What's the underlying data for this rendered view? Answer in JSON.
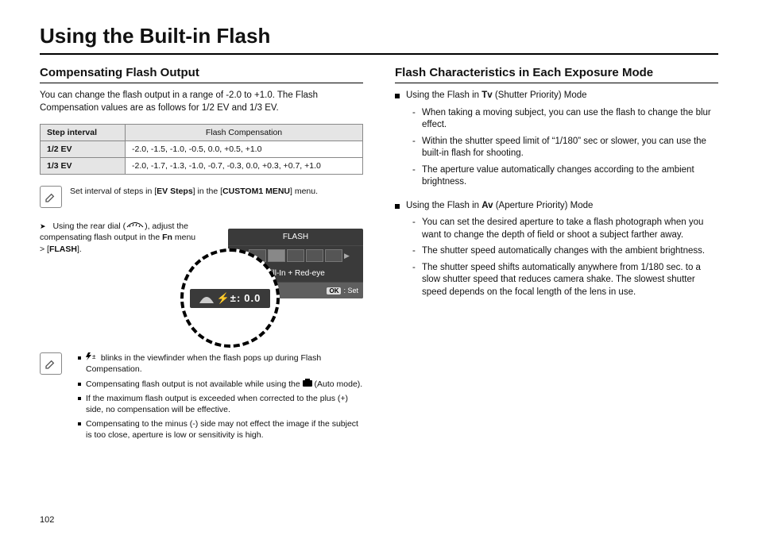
{
  "page": {
    "title": "Using the Built-in Flash",
    "number": "102"
  },
  "left": {
    "heading": "Compensating Flash Output",
    "intro": "You can change the flash output in a range of -2.0 to +1.0. The Flash Compensation values are as follows for 1/2 EV and 1/3 EV.",
    "table": {
      "h_step": "Step interval",
      "h_comp": "Flash Compensation",
      "r1_step": "1/2 EV",
      "r1_vals": "-2.0, -1.5, -1.0, -0.5, 0.0, +0.5, +1.0",
      "r2_step": "1/3 EV",
      "r2_vals": "-2.0, -1.7, -1.3, -1.0, -0.7, -0.3, 0.0, +0.3, +0.7, +1.0"
    },
    "note1_pre": "Set interval of steps in [",
    "note1_b1": "EV Steps",
    "note1_mid": "] in the [",
    "note1_b2": "CUSTOM1 MENU",
    "note1_post": "] menu.",
    "callout_pre": "Using the rear dial (",
    "callout_mid": "), adjust the compensating flash output in the ",
    "callout_b1": "Fn",
    "callout_mid2": " menu > [",
    "callout_b2": "FLASH",
    "callout_post": "].",
    "lcd": {
      "title": "FLASH",
      "mode": "Fill-In + Red-eye",
      "set": ": Set",
      "ok": "OK",
      "zoom_value": "0.0"
    },
    "notes2": {
      "n1_mid": " blinks in the viewfinder when the flash pops up during Flash Compensation.",
      "n2_pre": "Compensating flash output is not available while using the ",
      "n2_post": " (Auto mode).",
      "n3": "If the maximum flash output is exceeded when corrected to the plus (+) side, no compensation will be effective.",
      "n4": "Compensating to the minus (-) side may not effect the image if the subject is too close, aperture is low or sensitivity is high."
    }
  },
  "right": {
    "heading": "Flash Characteristics in Each Exposure Mode",
    "tv_pre": "Using the Flash in ",
    "tv_b": "Tv",
    "tv_post": " (Shutter Priority) Mode",
    "tv_items": {
      "i1": "When taking a moving subject, you can use the flash to change the blur effect.",
      "i2": "Within the shutter speed limit of “1/180” sec or slower, you can use the built-in flash for shooting.",
      "i3": "The aperture value automatically changes according to the ambient brightness."
    },
    "av_pre": "Using the Flash in ",
    "av_b": "Av",
    "av_post": " (Aperture Priority) Mode",
    "av_items": {
      "i1": "You can set the desired aperture to take a flash photograph when you want to change the depth of field or shoot a subject farther away.",
      "i2": "The shutter speed automatically changes with the ambient brightness.",
      "i3": "The shutter speed shifts automatically anywhere from 1/180 sec. to a slow shutter speed that reduces camera shake. The slowest shutter speed depends on the focal length of the lens in use."
    }
  }
}
